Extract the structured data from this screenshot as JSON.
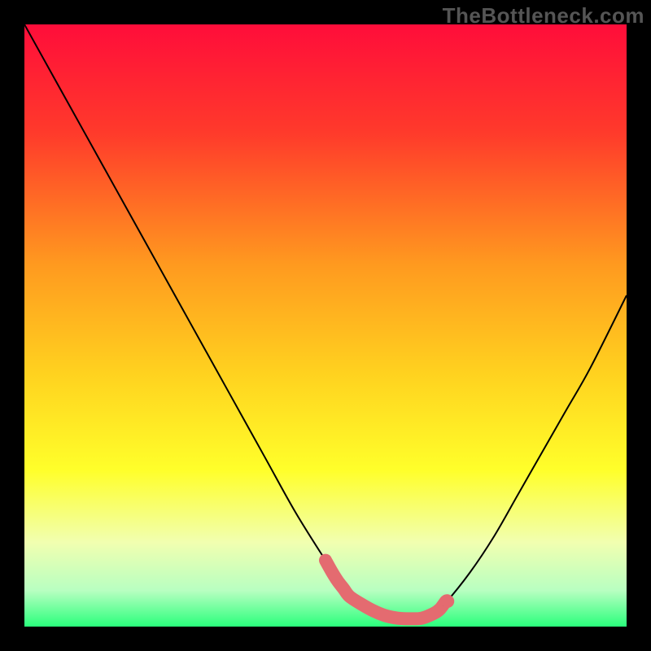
{
  "watermark": "TheBottleneck.com",
  "chart_data": {
    "type": "line",
    "title": "",
    "xlabel": "",
    "ylabel": "",
    "xlim": [
      0,
      100
    ],
    "ylim": [
      0,
      100
    ],
    "grid": false,
    "legend": false,
    "gradient_stops": [
      {
        "offset": 0.0,
        "color": "#ff0d3a"
      },
      {
        "offset": 0.18,
        "color": "#ff3a2b"
      },
      {
        "offset": 0.4,
        "color": "#ff9a1f"
      },
      {
        "offset": 0.58,
        "color": "#ffd21f"
      },
      {
        "offset": 0.74,
        "color": "#ffff2a"
      },
      {
        "offset": 0.86,
        "color": "#f1ffb0"
      },
      {
        "offset": 0.94,
        "color": "#b8ffc1"
      },
      {
        "offset": 1.0,
        "color": "#2aff7c"
      }
    ],
    "series": [
      {
        "name": "bottleneck-curve",
        "color": "#000000",
        "stroke_width": 2,
        "x": [
          0,
          5,
          10,
          15,
          20,
          25,
          30,
          35,
          40,
          45,
          50,
          52,
          54,
          56,
          58,
          60,
          62,
          64,
          66,
          68,
          70,
          74,
          78,
          82,
          86,
          90,
          94,
          100
        ],
        "y": [
          100,
          91,
          82,
          73,
          64,
          55,
          46,
          37,
          28,
          19,
          11,
          8,
          5.5,
          3.7,
          2.4,
          1.6,
          1.3,
          1.2,
          1.3,
          2.2,
          4.0,
          9,
          15,
          22,
          29,
          36,
          43,
          55
        ]
      },
      {
        "name": "sweet-spot-marker",
        "color": "#e46b70",
        "stroke_width": 16,
        "linecap": "round",
        "x": [
          50,
          51,
          52,
          53,
          54,
          56,
          58,
          60,
          62,
          64,
          66,
          68,
          69,
          70,
          70.3
        ],
        "y": [
          11,
          9.2,
          7.6,
          6.3,
          5.0,
          3.7,
          2.6,
          1.8,
          1.4,
          1.3,
          1.4,
          2.2,
          2.9,
          4.2,
          4.2
        ]
      }
    ]
  }
}
